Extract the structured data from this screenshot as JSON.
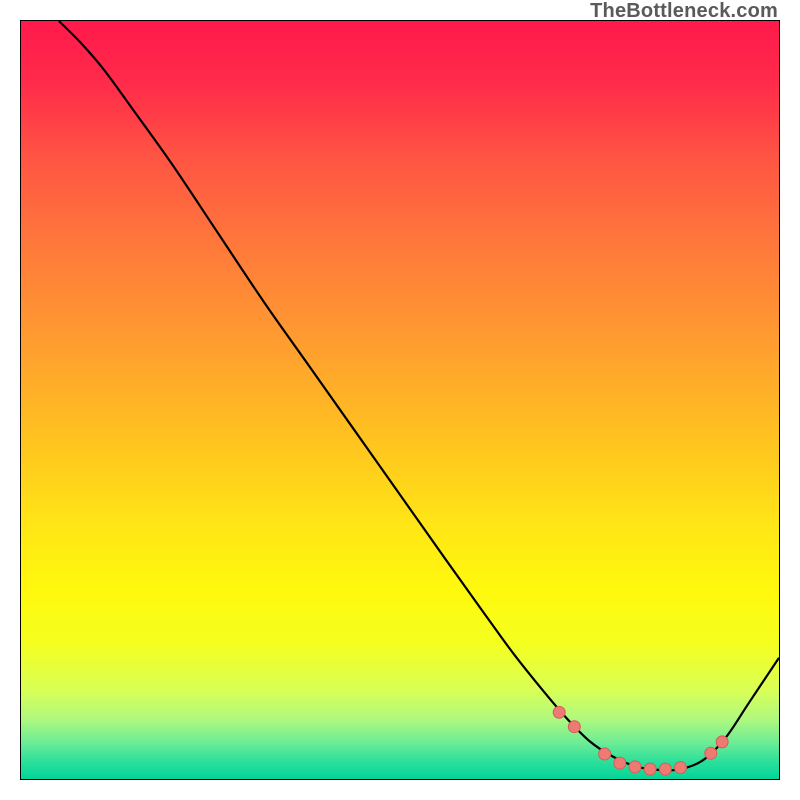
{
  "watermark": "TheBottleneck.com",
  "colors": {
    "border": "#000000",
    "curve_stroke": "#000000",
    "marker_fill": "#ed7b74",
    "marker_stroke": "#d85c55"
  },
  "gradient_stops": [
    {
      "pos": 0.0,
      "color": "#ff1a4b"
    },
    {
      "pos": 0.08,
      "color": "#ff2b4a"
    },
    {
      "pos": 0.18,
      "color": "#ff5543"
    },
    {
      "pos": 0.3,
      "color": "#ff7a3a"
    },
    {
      "pos": 0.42,
      "color": "#ff9c30"
    },
    {
      "pos": 0.55,
      "color": "#ffc31f"
    },
    {
      "pos": 0.66,
      "color": "#ffe516"
    },
    {
      "pos": 0.75,
      "color": "#fff90d"
    },
    {
      "pos": 0.82,
      "color": "#f4ff20"
    },
    {
      "pos": 0.88,
      "color": "#d9ff55"
    },
    {
      "pos": 0.92,
      "color": "#aef980"
    },
    {
      "pos": 0.95,
      "color": "#6ded96"
    },
    {
      "pos": 0.975,
      "color": "#2de09b"
    },
    {
      "pos": 1.0,
      "color": "#00d49a"
    }
  ],
  "chart_data": {
    "type": "line",
    "title": "",
    "xlabel": "",
    "ylabel": "",
    "xlim": [
      0,
      100
    ],
    "ylim": [
      0,
      100
    ],
    "grid": false,
    "legend": false,
    "series": [
      {
        "name": "bottleneck-curve",
        "x": [
          5,
          8,
          11,
          15,
          20,
          26,
          32,
          38,
          44,
          50,
          56,
          61,
          65,
          69,
          72,
          75,
          78,
          81,
          84,
          87,
          90,
          93,
          96,
          100
        ],
        "y": [
          100,
          97,
          93.5,
          88,
          81,
          72,
          63,
          54.5,
          46,
          37.5,
          29,
          22,
          16.5,
          11.5,
          8,
          5,
          3,
          1.7,
          1.2,
          1.3,
          2.5,
          5.5,
          10,
          16
        ]
      }
    ],
    "markers": {
      "series": "bottleneck-curve",
      "points": [
        {
          "x": 71,
          "y": 8.8
        },
        {
          "x": 73,
          "y": 6.9
        },
        {
          "x": 77,
          "y": 3.3
        },
        {
          "x": 79,
          "y": 2.1
        },
        {
          "x": 81,
          "y": 1.6
        },
        {
          "x": 83,
          "y": 1.3
        },
        {
          "x": 85,
          "y": 1.3
        },
        {
          "x": 87,
          "y": 1.5
        },
        {
          "x": 91,
          "y": 3.4
        },
        {
          "x": 92.5,
          "y": 4.9
        }
      ],
      "radius": 6
    }
  }
}
